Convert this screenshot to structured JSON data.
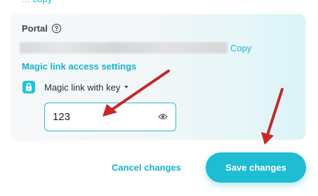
{
  "top_fragment": {
    "text": "…",
    "link": "copy"
  },
  "portal": {
    "label": "Portal",
    "copy_label": "Copy"
  },
  "magic_link": {
    "section_title": "Magic link access settings",
    "mode_value": "Magic link with key",
    "key_value": "123"
  },
  "footer": {
    "cancel_label": "Cancel changes",
    "save_label": "Save changes"
  },
  "colors": {
    "accent": "#1fbcd5",
    "annotation_arrow": "#c62828"
  },
  "icons": [
    "help-circle-icon",
    "lock-icon",
    "caret-down-icon",
    "eye-icon",
    "annotation-arrow"
  ]
}
